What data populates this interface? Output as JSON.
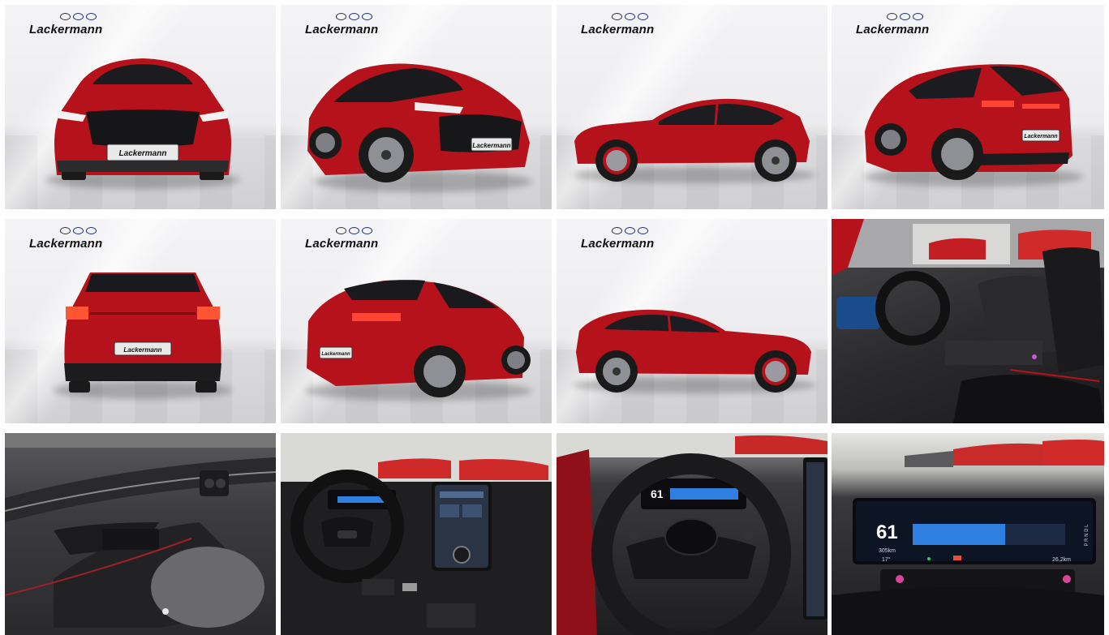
{
  "gallery": {
    "brand_text": "Lackermann",
    "plate_text": "Lackermann",
    "dash_speed": "61",
    "dash_range": "305km",
    "dash_gears": "P R N D L",
    "dash_temp": "17°",
    "dash_odo": "26.2km",
    "colors": {
      "body_red": "#b5121b",
      "dark_red": "#7a0b12",
      "tire": "#1a1a1a",
      "rim": "#9a9aa0",
      "screen_blue": "#2f7fe0"
    },
    "tiles": [
      {
        "view": "front",
        "icon": "car-front"
      },
      {
        "view": "front-three-quarter-left",
        "icon": "car-three-quarter"
      },
      {
        "view": "side-left",
        "icon": "car-side"
      },
      {
        "view": "rear-three-quarter-right",
        "icon": "car-three-quarter"
      },
      {
        "view": "rear",
        "icon": "car-rear"
      },
      {
        "view": "rear-three-quarter-left",
        "icon": "car-three-quarter"
      },
      {
        "view": "side-right",
        "icon": "car-side"
      },
      {
        "view": "interior-front-seats",
        "icon": "seat"
      },
      {
        "view": "door-panel",
        "icon": "door"
      },
      {
        "view": "dashboard-wide",
        "icon": "dashboard"
      },
      {
        "view": "steering-wheel",
        "icon": "steering-wheel"
      },
      {
        "view": "instrument-cluster",
        "icon": "gauge"
      }
    ]
  }
}
